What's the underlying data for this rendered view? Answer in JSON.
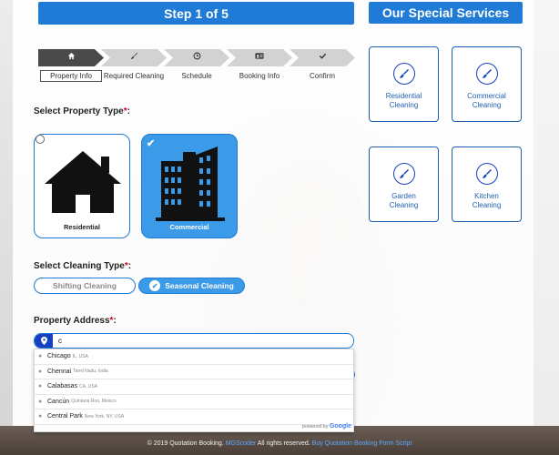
{
  "left_header": "Step 1 of 5",
  "right_header": "Our Special Services",
  "steps": [
    {
      "label": "Property Info",
      "icon": "home-icon"
    },
    {
      "label": "Required Cleaning",
      "icon": "brush-icon"
    },
    {
      "label": "Schedule",
      "icon": "clock-icon"
    },
    {
      "label": "Booking Info",
      "icon": "id-card-icon"
    },
    {
      "label": "Confirm",
      "icon": "check-icon"
    }
  ],
  "property_type": {
    "label": "Select Property Type",
    "required_mark": "*",
    "colon": ":",
    "options": [
      {
        "label": "Residential",
        "selected": false
      },
      {
        "label": "Commercial",
        "selected": true
      }
    ]
  },
  "cleaning_type": {
    "label": "Select Cleaning Type",
    "required_mark": "*",
    "colon": ":",
    "options": [
      {
        "label": "Shifting Cleaning",
        "selected": false
      },
      {
        "label": "Seasonal Cleaning",
        "selected": true
      }
    ]
  },
  "address": {
    "label": "Property Address",
    "required_mark": "*",
    "colon": ":",
    "value": "c",
    "suggestions": [
      {
        "main": "Chicago",
        "secondary": "IL, USA"
      },
      {
        "main": "Chennai",
        "secondary": "Tamil Nadu, India"
      },
      {
        "main": "Calabasas",
        "secondary": "CA, USA"
      },
      {
        "main": "Cancún",
        "secondary": "Quintana Roo, Mexico"
      },
      {
        "main": "Central Park",
        "secondary": "New York, NY, USA"
      }
    ],
    "powered_by": "powered by",
    "powered_brand": "Google"
  },
  "services": [
    {
      "line1": "Residential",
      "line2": "Cleaning"
    },
    {
      "line1": "Commercial",
      "line2": "Cleaning"
    },
    {
      "line1": "Garden",
      "line2": "Cleaning"
    },
    {
      "line1": "Kitchen",
      "line2": "Cleaning"
    }
  ],
  "footer": {
    "prefix": "© 2019 Quotation Booking.",
    "brand": "MGScoder",
    "middle": "All rights reserved.",
    "link": "Buy Quotation Booking Form Script"
  },
  "colors": {
    "accent": "#1f7bd6",
    "selected_fill": "#3c9be8",
    "required": "#d0021b"
  }
}
